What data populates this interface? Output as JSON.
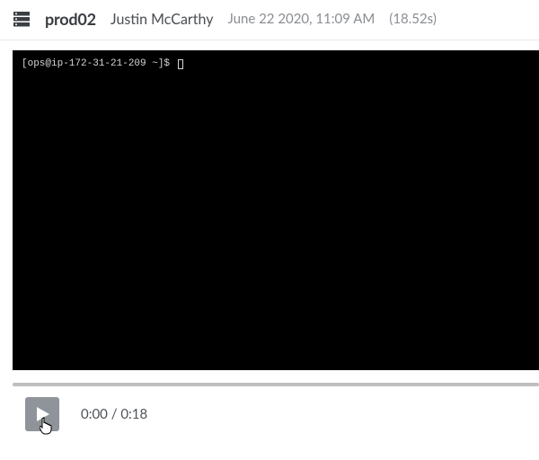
{
  "header": {
    "hostname": "prod02",
    "user": "Justin McCarthy",
    "datetime": "June 22 2020, 11:09 AM",
    "duration": "(18.52s)"
  },
  "terminal": {
    "prompt": "[ops@ip-172-31-21-209 ~]$"
  },
  "playback": {
    "current": "0:00",
    "total": "0:18"
  }
}
